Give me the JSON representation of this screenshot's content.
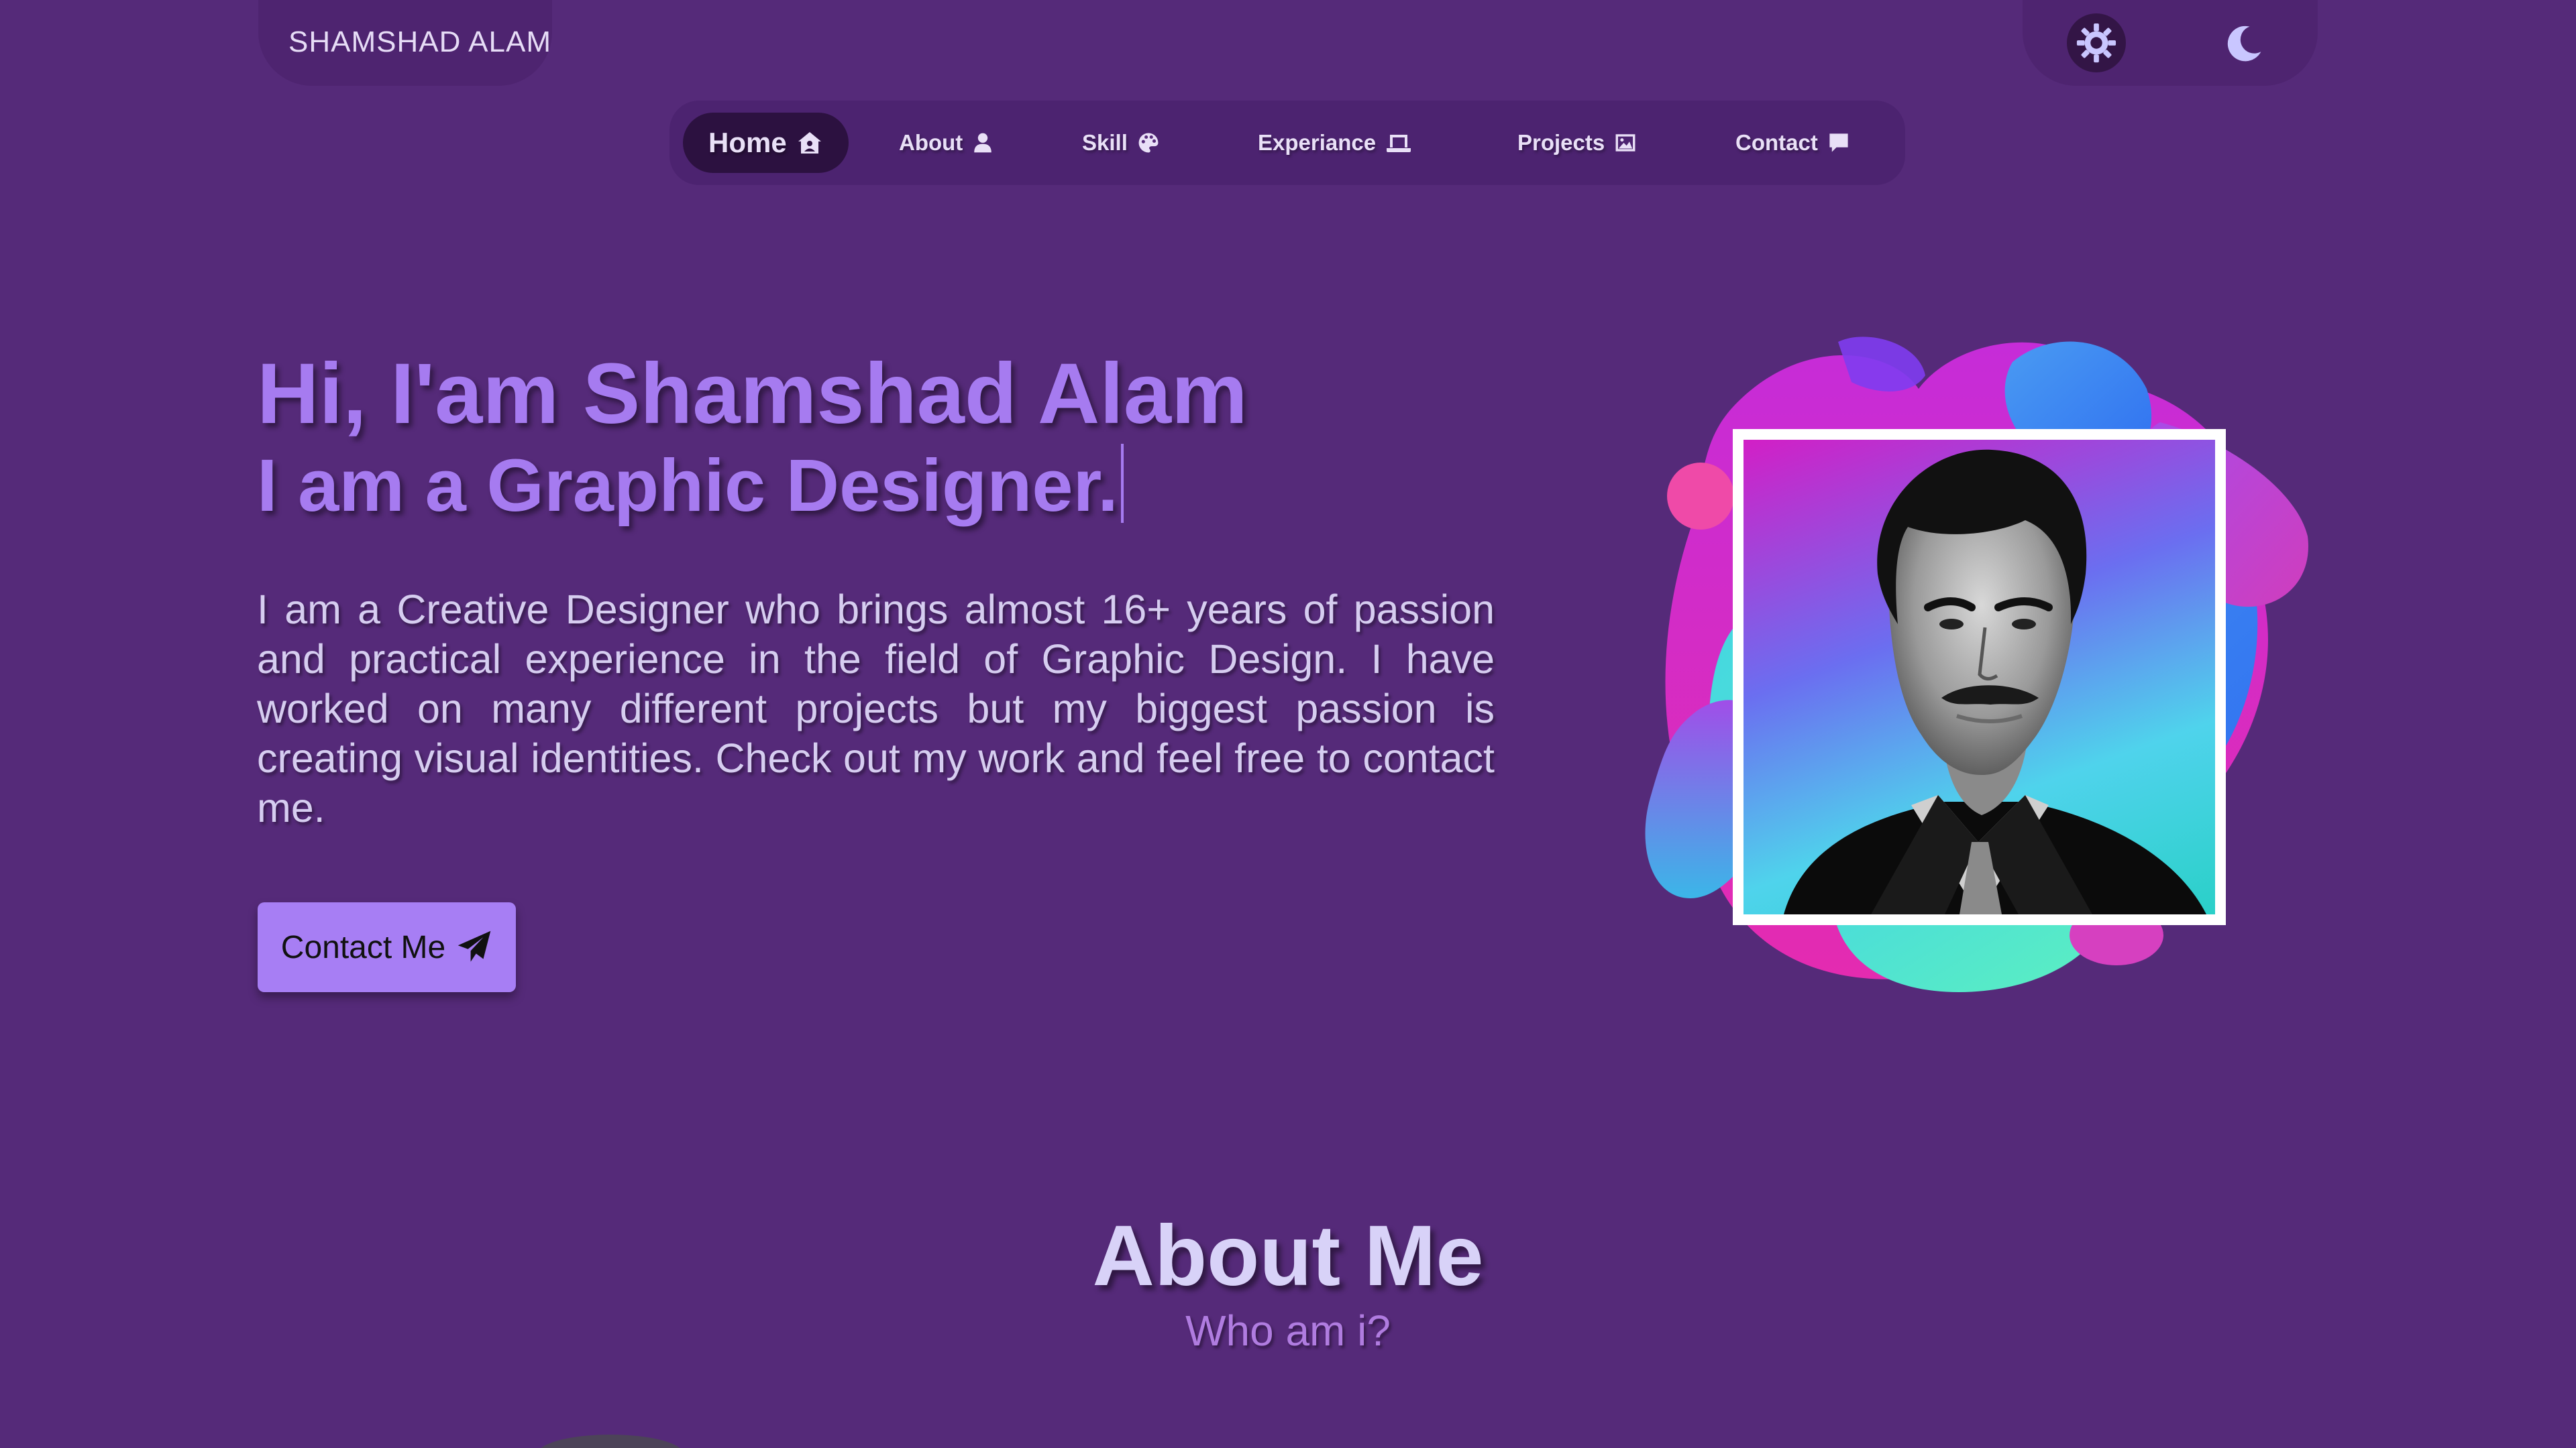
{
  "header": {
    "brand": "SHAMSHAD ALAM",
    "theme_light_icon": "gear-sun-icon",
    "theme_dark_icon": "moon-icon"
  },
  "nav": {
    "items": [
      {
        "label": "Home",
        "icon": "house-user-icon"
      },
      {
        "label": "About",
        "icon": "user-icon"
      },
      {
        "label": "Skill",
        "icon": "palette-icon"
      },
      {
        "label": "Experiance",
        "icon": "laptop-icon"
      },
      {
        "label": "Projects",
        "icon": "image-icon"
      },
      {
        "label": "Contact",
        "icon": "comment-icon"
      }
    ],
    "active": "Home"
  },
  "hero": {
    "title": "Hi, I'am Shamshad Alam",
    "subtitle": "I am a Graphic Designer.",
    "description": "I am a Creative Designer who brings almost 16+ years of passion and practical experience in the field of Graphic Design. I have worked on many different projects but my biggest passion is creating visual identities. Check out my work and feel free to contact me.",
    "cta_label": "Contact Me",
    "cta_icon": "paper-plane-icon"
  },
  "about": {
    "title": "About Me",
    "subtitle": "Who am i?"
  },
  "colors": {
    "background": "#552a79",
    "accent": "#a67bf0",
    "nav_bg": "#4c2370",
    "active_nav_bg": "#2c1140"
  }
}
